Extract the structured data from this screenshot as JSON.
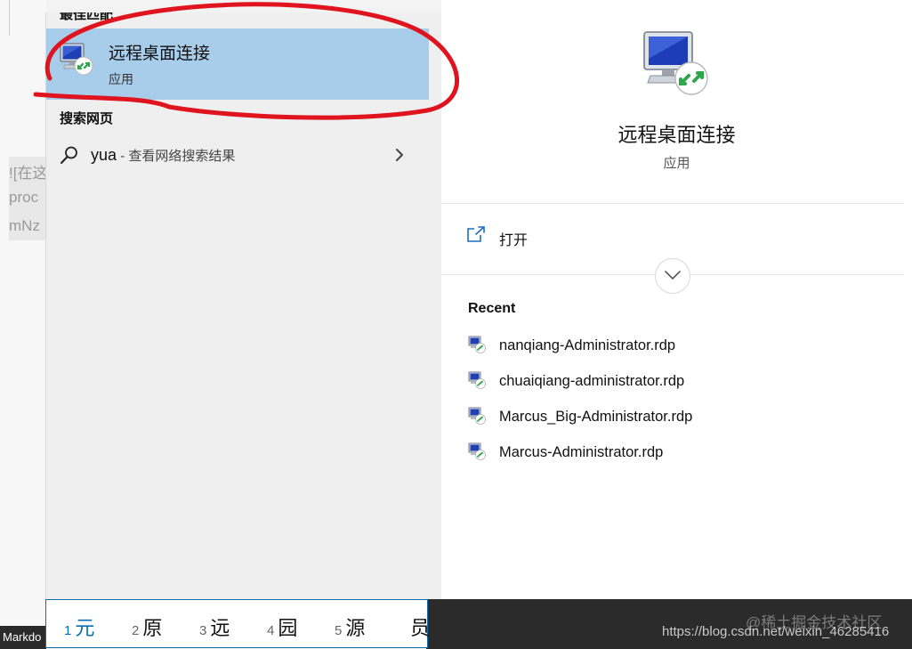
{
  "background_editor": {
    "line1": "![在这",
    "line2": "proc",
    "line3": "mNz",
    "taskbar_label": "Markdo"
  },
  "search_results": {
    "best_match_title": "最佳匹配",
    "best_match": {
      "name": "远程桌面连接",
      "type": "应用",
      "icon": "remote-desktop-icon"
    },
    "web_section_title": "搜索网页",
    "web_item": {
      "query": "yua",
      "hint": " - 查看网络搜索结果",
      "icon": "search-icon"
    }
  },
  "details": {
    "app_name": "远程桌面连接",
    "app_type": "应用",
    "open_label": "打开",
    "recent_title": "Recent",
    "recent_items": [
      "nanqiang-Administrator.rdp",
      "chuaiqiang-administrator.rdp",
      "Marcus_Big-Administrator.rdp",
      "Marcus-Administrator.rdp"
    ]
  },
  "ime": {
    "candidates": [
      {
        "num": "1",
        "char": "元"
      },
      {
        "num": "2",
        "char": "原"
      },
      {
        "num": "3",
        "char": "远"
      },
      {
        "num": "4",
        "char": "园"
      },
      {
        "num": "5",
        "char": "源"
      },
      {
        "num": "",
        "char": "员"
      }
    ]
  },
  "watermark": {
    "brand": "@稀土掘金技术社区",
    "url": "https://blog.csdn.net/weixin_46285416"
  },
  "colors": {
    "selection": "#a8cdea",
    "accent": "#0a6fb0",
    "annotation": "#e0141e",
    "taskbar": "#2b2b2b"
  }
}
